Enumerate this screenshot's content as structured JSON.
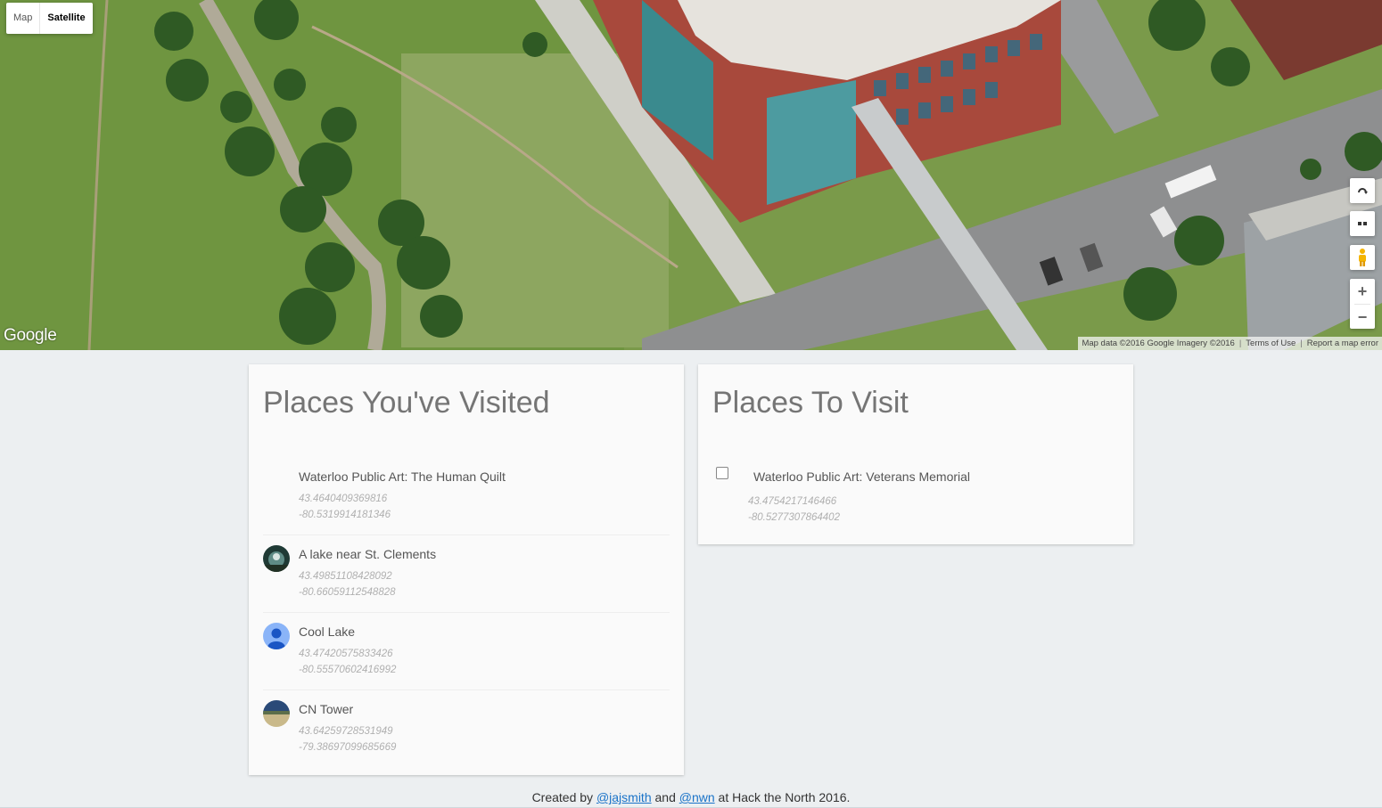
{
  "map": {
    "type_control": {
      "map_label": "Map",
      "satellite_label": "Satellite",
      "active": "satellite"
    },
    "logo": "Google",
    "attribution": {
      "data": "Map data ©2016 Google Imagery ©2016",
      "terms": "Terms of Use",
      "report": "Report a map error"
    },
    "controls": {
      "zoom_in": "+",
      "zoom_out": "−"
    }
  },
  "visited": {
    "title": "Places You've Visited",
    "items": [
      {
        "name": "Waterloo Public Art: The Human Quilt",
        "lat": "43.4640409369816",
        "lng": "-80.5319914181346",
        "avatar": "none"
      },
      {
        "name": "A lake near St. Clements",
        "lat": "43.49851108428092",
        "lng": "-80.66059112548828",
        "avatar": "photo-lake"
      },
      {
        "name": "Cool Lake",
        "lat": "43.47420575833426",
        "lng": "-80.55570602416992",
        "avatar": "default-user"
      },
      {
        "name": "CN Tower",
        "lat": "43.64259728531949",
        "lng": "-79.38697099685669",
        "avatar": "photo-field"
      }
    ]
  },
  "to_visit": {
    "title": "Places To Visit",
    "items": [
      {
        "name": "Waterloo Public Art: Veterans Memorial",
        "lat": "43.4754217146466",
        "lng": "-80.5277307864402",
        "checked": false
      }
    ]
  },
  "footer": {
    "prefix": "Created by ",
    "user1": "@jajsmith",
    "middle": " and ",
    "user2": "@nwn",
    "suffix": " at Hack the North 2016."
  }
}
